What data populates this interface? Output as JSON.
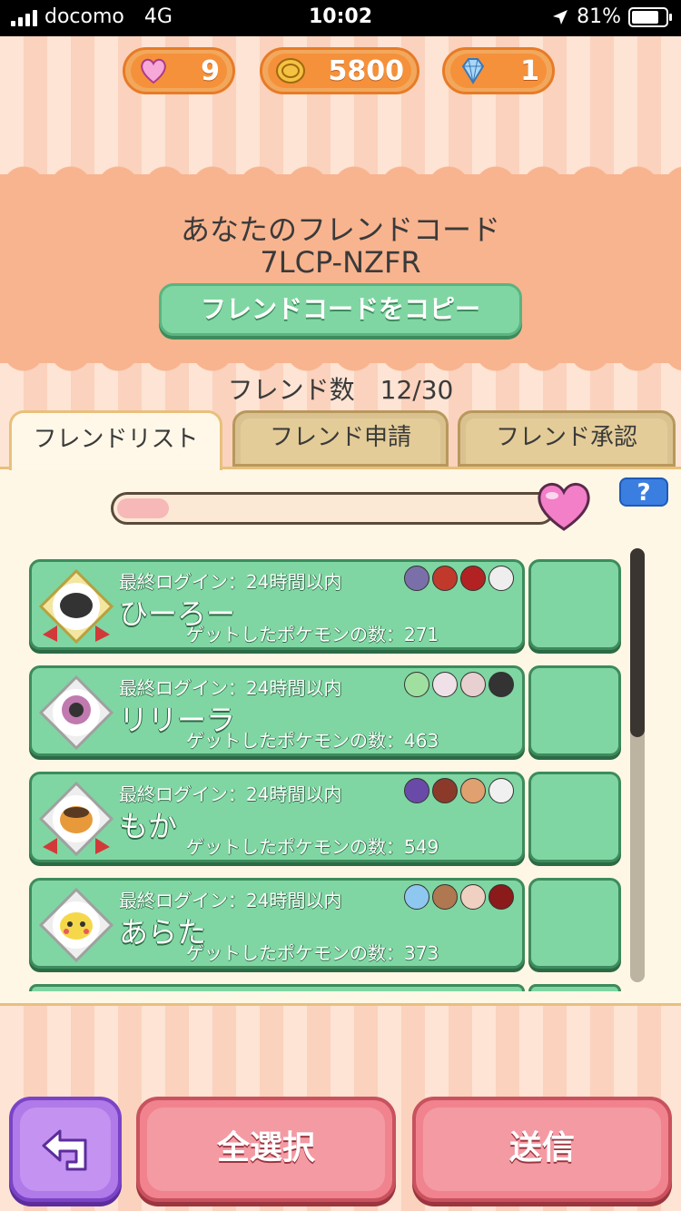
{
  "status_bar": {
    "carrier": "docomo",
    "network": "4G",
    "time": "10:02",
    "battery": "81%"
  },
  "currencies": [
    {
      "icon": "heart-icon",
      "value": "9"
    },
    {
      "icon": "coin-icon",
      "value": "5800"
    },
    {
      "icon": "gem-icon",
      "value": "1"
    }
  ],
  "banner": {
    "title": "あなたのフレンドコード",
    "code": "7LCP-NZFR",
    "copy_label": "フレンドコードをコピー"
  },
  "friend_count": "フレンド数　12/30",
  "tabs": [
    {
      "label": "フレンドリスト",
      "active": true
    },
    {
      "label": "フレンド申請",
      "active": false
    },
    {
      "label": "フレンド承認",
      "active": false
    }
  ],
  "gauge": {
    "fill_fraction": 0.12
  },
  "help_label": "?",
  "friends": [
    {
      "login": "最終ログイン：24時間以内",
      "name": "ひーろー",
      "count": "ゲットしたポケモンの数：271",
      "mon_colors": [
        "#7a6fa8",
        "#c0392b",
        "#b22222",
        "#eeeeee"
      ]
    },
    {
      "login": "最終ログイン：24時間以内",
      "name": "リリーラ",
      "count": "ゲットしたポケモンの数：463",
      "mon_colors": [
        "#9fe0a0",
        "#f0e0e8",
        "#e8d0d0",
        "#333333"
      ]
    },
    {
      "login": "最終ログイン：24時間以内",
      "name": "もか",
      "count": "ゲットしたポケモンの数：549",
      "mon_colors": [
        "#6a4aa8",
        "#8b3a2a",
        "#e0a070",
        "#f0f0f0"
      ]
    },
    {
      "login": "最終ログイン：24時間以内",
      "name": "あらた",
      "count": "ゲットしたポケモンの数：373",
      "mon_colors": [
        "#8ec8f0",
        "#b07850",
        "#f0d0c0",
        "#8b1a1a"
      ]
    }
  ],
  "buttons": {
    "select_all": "全選択",
    "send": "送信"
  },
  "colors": {
    "accent_green": "#7fd6a2",
    "button_pink": "#f1838f",
    "back_purple": "#b07ae8",
    "help_blue": "#3a7fe0"
  }
}
